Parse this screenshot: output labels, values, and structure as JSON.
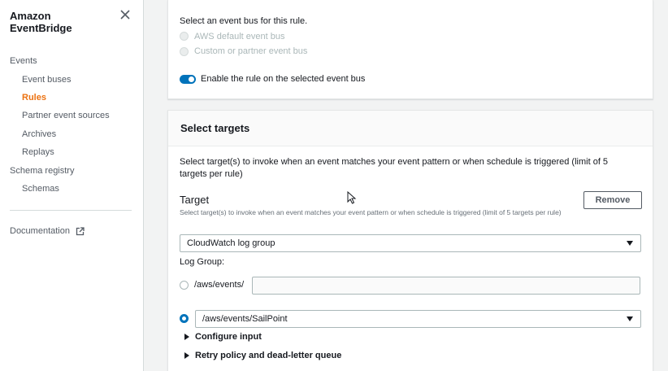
{
  "sidebar": {
    "brand_line1": "Amazon",
    "brand_line2": "EventBridge",
    "close_icon": "close-icon",
    "items": [
      {
        "label": "Events"
      },
      {
        "label": "Event buses"
      },
      {
        "label": "Rules"
      },
      {
        "label": "Partner event sources"
      },
      {
        "label": "Archives"
      },
      {
        "label": "Replays"
      },
      {
        "label": "Schema registry"
      },
      {
        "label": "Schemas"
      }
    ],
    "active_item": "Rules",
    "documentation_label": "Documentation",
    "documentation_icon": "external-link-icon"
  },
  "event_bus": {
    "prompt": "Select an event bus for this rule.",
    "options": [
      {
        "label": "AWS default event bus",
        "disabled": true
      },
      {
        "label": "Custom or partner event bus",
        "disabled": true
      }
    ],
    "toggle_label": "Enable the rule on the selected event bus",
    "toggle_on": true
  },
  "targets": {
    "section_title": "Select targets",
    "description": "Select target(s) to invoke when an event matches your event pattern or when schedule is triggered (limit of 5 targets per rule)",
    "target_label": "Target",
    "target_hint": "Select target(s) to invoke when an event matches your event pattern or when schedule is triggered (limit of 5 targets per rule)",
    "remove_button": "Remove",
    "target_type": "CloudWatch log group",
    "log_group_label": "Log Group:",
    "new_log_group_prefix": "/aws/events/",
    "new_log_group_value": "",
    "existing_log_group": "/aws/events/SailPoint",
    "configure_input": "Configure input",
    "retry_policy": "Retry policy and dead-letter queue"
  },
  "colors": {
    "accent_blue": "#0073bb",
    "active_nav": "#ec7211",
    "background": "#f2f3f3"
  }
}
